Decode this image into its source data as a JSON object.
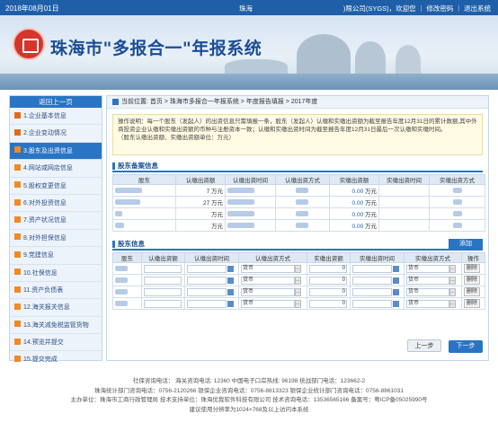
{
  "topbar": {
    "date": "2018年08月01日",
    "user": "珠海",
    "right_text": ")限公司(SYGS)，欢迎您 ｜ 修改密码 ｜ 退出系统"
  },
  "banner": {
    "title": "珠海市\"多报合一\"年报系统"
  },
  "sidebar": {
    "back": "返回上一页",
    "items": [
      {
        "label": "1.企业基本信息"
      },
      {
        "label": "2.企业变动情况"
      },
      {
        "label": "3.股东及出资信息"
      },
      {
        "label": "4.网站或网店信息"
      },
      {
        "label": "5.股权变更信息"
      },
      {
        "label": "6.对外投资信息"
      },
      {
        "label": "7.资产状况信息"
      },
      {
        "label": "8.对外担保信息"
      },
      {
        "label": "9.党建信息"
      },
      {
        "label": "10.社保信息"
      },
      {
        "label": "11.资产负债表"
      },
      {
        "label": "12.海关报关信息"
      },
      {
        "label": "13.海关减免税监管货物"
      },
      {
        "label": "14.预览并提交"
      },
      {
        "label": "15.提交完成"
      }
    ]
  },
  "crumb": "当前位置: 首页 > 珠海市多报合一年报系统 > 年度报告填报 > 2017年度",
  "note": {
    "line1": "操作说明：每一个股东（发起人）的出资信息只需填报一条，股东（发起人）认缴和实缴出资额为截至报告年度12月31日的累计数额,其中外商投资企业认缴和实缴出资额的币种与注册资本一致；认缴和实缴出资时间为截至报告年度12月31日最后一次认缴和实缴时间。",
    "line2": "（股东认缴出资额、实缴出资额单位：万元）"
  },
  "record": {
    "title": "股东备案信息",
    "headers": [
      "股东",
      "认缴出资额",
      "认缴出资时间",
      "认缴出资方式",
      "实缴出资额",
      "实缴出资时间",
      "实缴出资方式"
    ],
    "rows": [
      {
        "sub": "7",
        "unit": "万元",
        "paid": "0.00",
        "punit": "万元"
      },
      {
        "sub": "27",
        "unit": "万元",
        "paid": "0.00",
        "punit": "万元"
      },
      {
        "sub": "",
        "unit": "万元",
        "paid": "0.00",
        "punit": "万元"
      },
      {
        "sub": "",
        "unit": "万元",
        "paid": "0.00",
        "punit": "万元"
      }
    ]
  },
  "info": {
    "title": "股东信息",
    "add_label": "添加",
    "headers": [
      "股东",
      "认缴出资额",
      "认缴出资时间",
      "认缴出资方式",
      "实缴出资额",
      "实缴出资时间",
      "实缴出资方式",
      "操作"
    ],
    "rows": [
      {
        "method": "货币",
        "paid": "0",
        "pmethod": "货币",
        "del": "删除"
      },
      {
        "method": "货币",
        "paid": "0",
        "pmethod": "货币",
        "del": "删除"
      },
      {
        "method": "货币",
        "paid": "0",
        "pmethod": "货币",
        "del": "删除"
      },
      {
        "method": "货币",
        "paid": "0",
        "pmethod": "货币",
        "del": "删除"
      }
    ]
  },
  "buttons": {
    "prev": "上一步",
    "next": "下一步"
  },
  "footer": {
    "l1": "社保咨询电话：   海关咨询电话: 12360   中国电子口岸热线: 96198   统战部门电话：123662-2",
    "l2": "珠海统计部门咨询电话：0756-2120266   银保企业咨询电话：0756-8813323   银保企业统计部门咨询电话：0756-8861031",
    "l3": "主办单位：珠海市工商行政管理局   技术支持单位：珠海优我软件科技有限公司   技术咨询电话：13536565166   备案号：粤ICP备05025990号",
    "l4": "建议使用分辨率为1024×768及以上访问本系统"
  }
}
